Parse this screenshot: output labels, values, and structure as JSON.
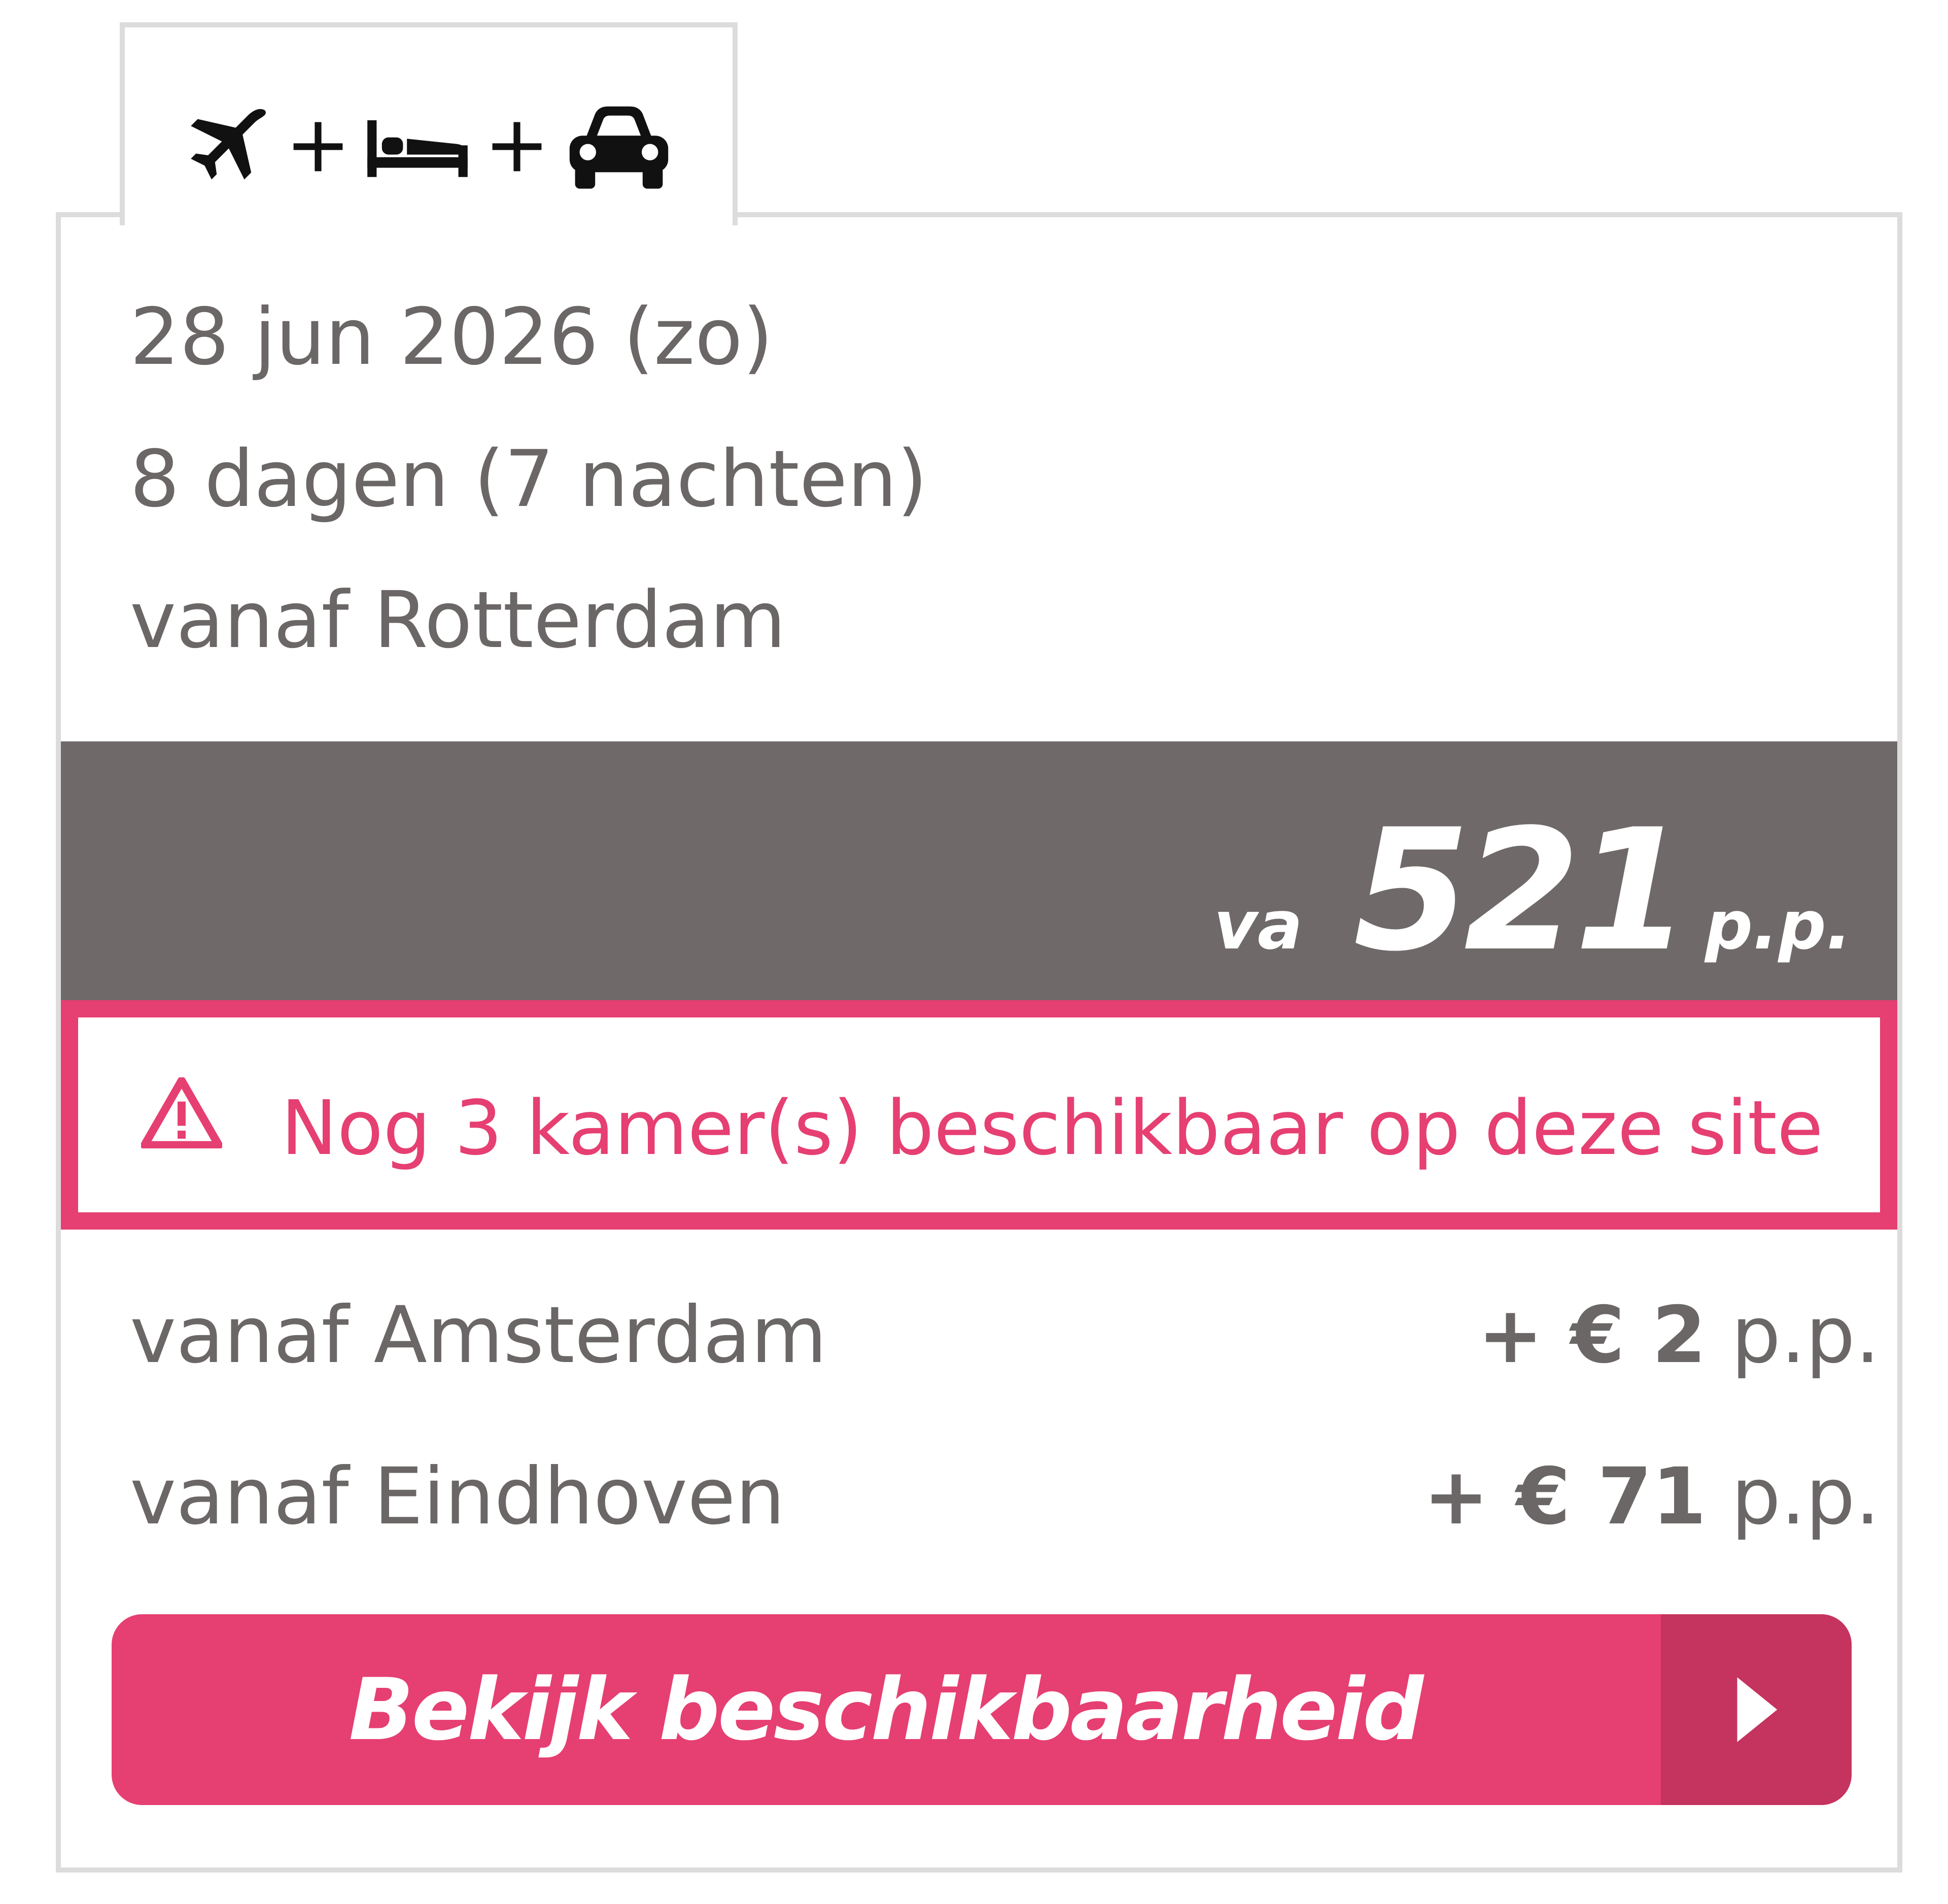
{
  "tab": {
    "icons": [
      "airplane-icon",
      "plus-icon",
      "bed-icon",
      "plus-icon",
      "car-icon"
    ],
    "separator": "+"
  },
  "details": {
    "date": "28 jun 2026 (zo)",
    "duration": "8 dagen (7 nachten)",
    "departure": "vanaf Rotterdam"
  },
  "price": {
    "prefix": "va",
    "amount": "521",
    "suffix": "p.p."
  },
  "alert": {
    "icon": "warning-triangle-icon",
    "text": "Nog 3 kamer(s) beschikbaar op deze site"
  },
  "alternatives": [
    {
      "label": "vanaf Amsterdam",
      "price": "+ € 2",
      "unit": "p.p."
    },
    {
      "label": "vanaf Eindhoven",
      "price": "+ € 71",
      "unit": "p.p."
    }
  ],
  "cta": {
    "label": "Bekijk beschikbaarheid",
    "icon": "chevron-right-icon"
  },
  "colors": {
    "accent": "#e63f72",
    "accent_dark": "#c5335f",
    "price_band": "#6f6a69",
    "text": "#6a6766",
    "border": "#dcdcdc"
  }
}
